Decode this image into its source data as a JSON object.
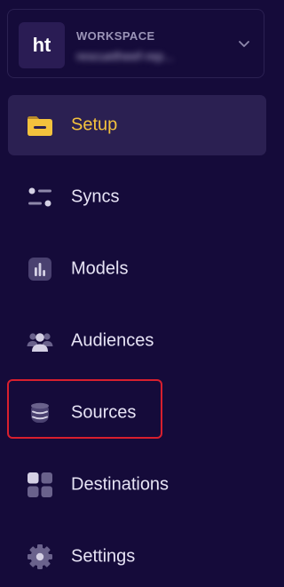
{
  "workspace": {
    "avatar_text": "ht",
    "label": "WORKSPACE",
    "name": "rescuetheef-rep..."
  },
  "nav": {
    "items": [
      {
        "label": "Setup",
        "icon": "folder-icon",
        "active": true
      },
      {
        "label": "Syncs",
        "icon": "sync-sliders-icon"
      },
      {
        "label": "Models",
        "icon": "bar-chart-icon"
      },
      {
        "label": "Audiences",
        "icon": "users-group-icon"
      },
      {
        "label": "Sources",
        "icon": "database-icon"
      },
      {
        "label": "Destinations",
        "icon": "grid-squares-icon"
      },
      {
        "label": "Settings",
        "icon": "gear-icon"
      }
    ]
  },
  "colors": {
    "background": "#150b3a",
    "active_bg": "#2b2052",
    "active_text": "#f4c23d",
    "text": "#e7e4f5",
    "highlight": "#d81f2e"
  }
}
